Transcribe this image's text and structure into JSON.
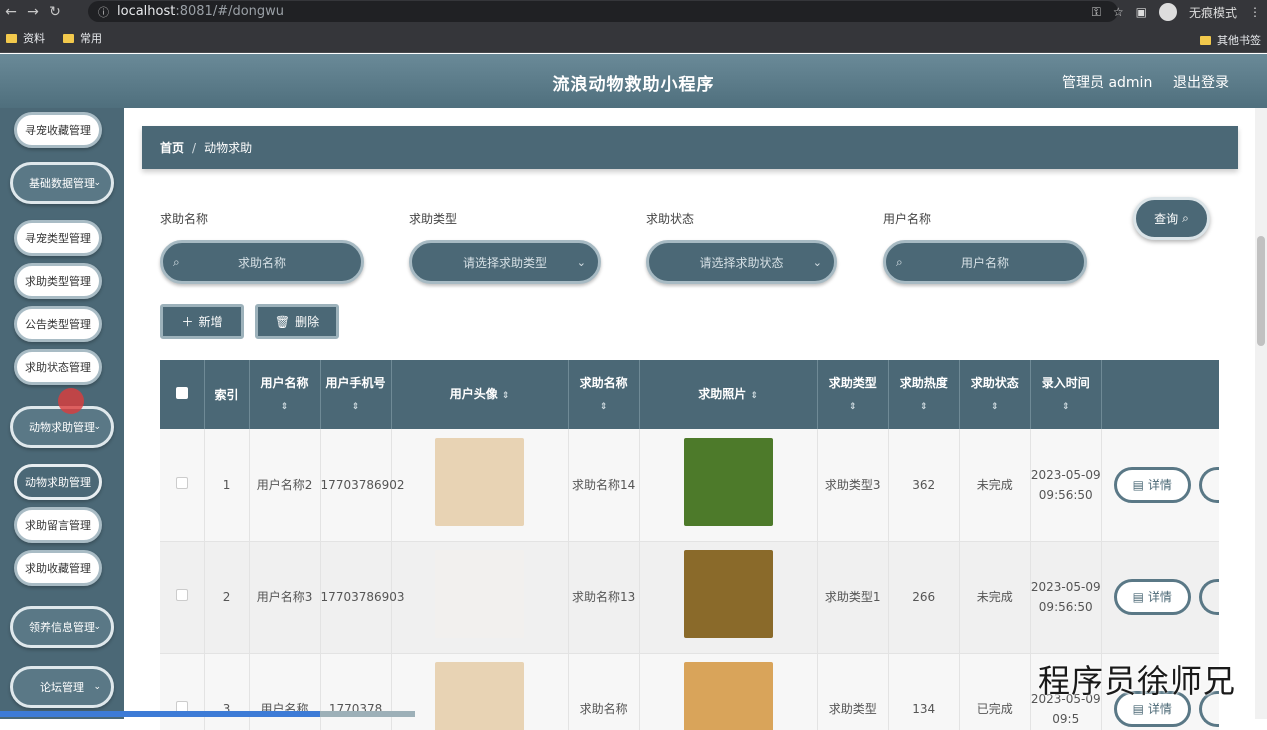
{
  "browser": {
    "url_host": "localhost",
    "url_path": ":8081/#/dongwu",
    "profile_label": "无痕模式",
    "bookmarks": [
      "资料",
      "常用"
    ],
    "other_bookmarks": "其他书签"
  },
  "header": {
    "title": "流浪动物救助小程序",
    "admin": "管理员 admin",
    "logout": "退出登录"
  },
  "sidebar": {
    "items": [
      {
        "label": "寻宠收藏管理",
        "kind": "item"
      },
      {
        "label": "基础数据管理",
        "kind": "group"
      },
      {
        "label": "寻宠类型管理",
        "kind": "item"
      },
      {
        "label": "求助类型管理",
        "kind": "item"
      },
      {
        "label": "公告类型管理",
        "kind": "item"
      },
      {
        "label": "求助状态管理",
        "kind": "item"
      },
      {
        "label": "动物求助管理",
        "kind": "group"
      },
      {
        "label": "动物求助管理",
        "kind": "active"
      },
      {
        "label": "求助留言管理",
        "kind": "item"
      },
      {
        "label": "求助收藏管理",
        "kind": "item"
      },
      {
        "label": "领养信息管理",
        "kind": "group"
      },
      {
        "label": "论坛管理",
        "kind": "group"
      }
    ]
  },
  "breadcrumb": {
    "home": "首页",
    "separator": "/",
    "current": "动物求助"
  },
  "filters": [
    {
      "label": "求助名称",
      "placeholder": "求助名称",
      "type": "search"
    },
    {
      "label": "求助类型",
      "placeholder": "请选择求助类型",
      "type": "select"
    },
    {
      "label": "求助状态",
      "placeholder": "请选择求助状态",
      "type": "select"
    },
    {
      "label": "用户名称",
      "placeholder": "用户名称",
      "type": "search"
    }
  ],
  "actions": {
    "query": "查询",
    "add": "新增",
    "delete": "删除"
  },
  "table": {
    "columns": [
      "索引",
      "用户名称",
      "用户手机号",
      "用户头像",
      "求助名称",
      "求助照片",
      "求助类型",
      "求助热度",
      "求助状态",
      "录入时间"
    ],
    "sort_glyph": "⇕",
    "detail_label": "详情",
    "rows": [
      {
        "index": "1",
        "user": "用户名称2",
        "phone": "17703786902",
        "name": "求助名称14",
        "type": "求助类型3",
        "heat": "362",
        "status": "未完成",
        "time": "2023-05-09 09:56:50",
        "avatar_color": "#e8d3b4",
        "photo_color": "#4d7a2a"
      },
      {
        "index": "2",
        "user": "用户名称3",
        "phone": "17703786903",
        "name": "求助名称13",
        "type": "求助类型1",
        "heat": "266",
        "status": "未完成",
        "time": "2023-05-09 09:56:50",
        "avatar_color": "#f2f0ee",
        "photo_color": "#8a6a2a"
      },
      {
        "index": "3",
        "user": "用户名称",
        "phone": "1770378",
        "name": "求助名称",
        "type": "求助类型",
        "heat": "134",
        "status": "已完成",
        "time": "2023-05-09 09:5",
        "avatar_color": "#e8d3b4",
        "photo_color": "#d9a45a"
      }
    ]
  },
  "watermark": "程序员徐师兄",
  "video_progress": 0.77
}
